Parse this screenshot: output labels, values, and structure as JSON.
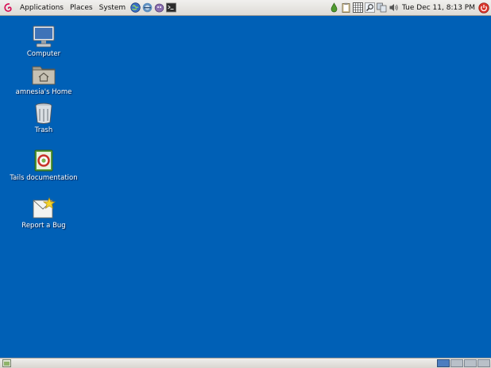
{
  "top_panel": {
    "menus": [
      {
        "label": "Applications"
      },
      {
        "label": "Places"
      },
      {
        "label": "System"
      }
    ],
    "launchers": [
      "network-icon",
      "tor-onion-icon",
      "pidgin-icon",
      "terminal-icon"
    ],
    "tray_icons": [
      "vidalia-onion-icon",
      "clipboard-icon",
      "keyboard-layout-icon",
      "search-icon",
      "network-manager-icon",
      "volume-icon"
    ],
    "clock": "Tue Dec 11,  8:13 PM"
  },
  "desktop": {
    "icons": [
      {
        "label": "Computer",
        "icon": "computer-icon"
      },
      {
        "label": "amnesia's Home",
        "icon": "home-folder-icon"
      },
      {
        "label": "Trash",
        "icon": "trash-icon"
      },
      {
        "label": "Tails documentation",
        "icon": "documentation-icon"
      },
      {
        "label": "Report a Bug",
        "icon": "report-bug-icon"
      }
    ]
  },
  "bottom_panel": {
    "workspace_count": 4,
    "active_workspace": 1
  },
  "colors": {
    "desktop_background": "#0060b6",
    "panel_background": "#e8e6e2"
  }
}
